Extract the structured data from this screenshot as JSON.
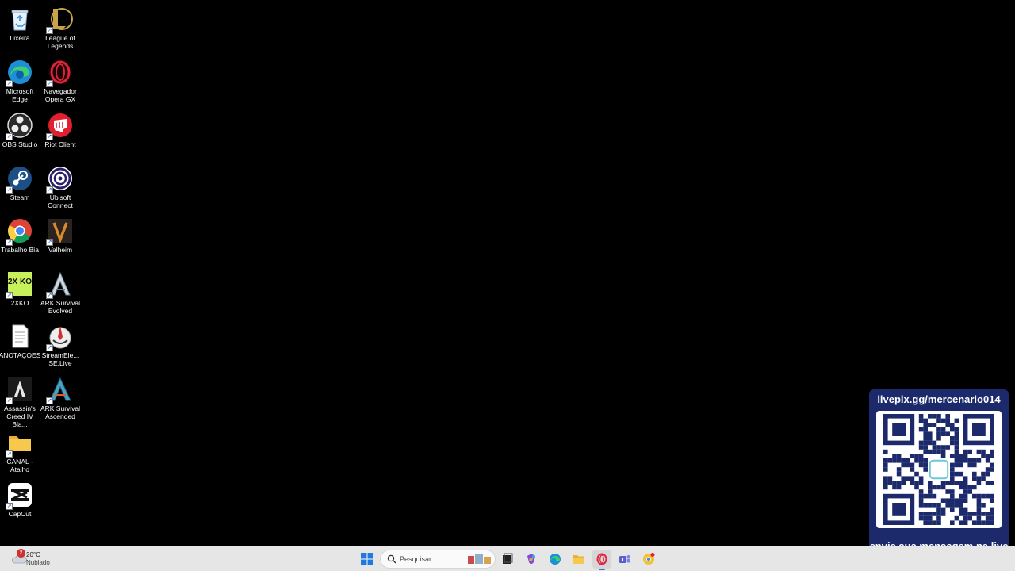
{
  "desktop": {
    "icons": [
      {
        "label": "Lixeira",
        "icon": "recycle-bin-icon"
      },
      {
        "label": "League of Legends",
        "icon": "league-of-legends-icon"
      },
      {
        "label": "Microsoft Edge",
        "icon": "edge-icon"
      },
      {
        "label": "Navegador Opera GX",
        "icon": "opera-gx-icon"
      },
      {
        "label": "OBS Studio",
        "icon": "obs-icon"
      },
      {
        "label": "Riot Client",
        "icon": "riot-client-icon"
      },
      {
        "label": "Steam",
        "icon": "steam-icon"
      },
      {
        "label": "Ubisoft Connect",
        "icon": "ubisoft-icon"
      },
      {
        "label": "Trabalho Bia",
        "icon": "chrome-icon"
      },
      {
        "label": "Valheim",
        "icon": "valheim-icon"
      },
      {
        "label": "2XKO",
        "icon": "2xko-icon",
        "icon_text": "2X KO"
      },
      {
        "label": "ARK Survival Evolved",
        "icon": "ark-icon"
      },
      {
        "label": "ANOTAÇOES",
        "icon": "text-file-icon"
      },
      {
        "label": "StreamEle... SE.Live",
        "icon": "streamelements-icon"
      },
      {
        "label": "Assassin's Creed IV Bla...",
        "icon": "assassins-creed-icon"
      },
      {
        "label": "ARK Survival Ascended",
        "icon": "ark-ascended-icon"
      },
      {
        "label": "CANAL - Atalho",
        "icon": "folder-icon"
      },
      {
        "label": "CapCut",
        "icon": "capcut-icon"
      }
    ]
  },
  "overlay": {
    "url": "livepix.gg/mercenario014",
    "message": "envie sua mensagem na live via pix!",
    "qr_icon": "qr-code-icon"
  },
  "taskbar": {
    "weather": {
      "temp": "20°C",
      "condition": "Nublado",
      "badge": "2",
      "icon": "cloud-icon"
    },
    "search": {
      "placeholder": "Pesquisar",
      "icon": "search-icon"
    },
    "apps": [
      {
        "name": "start-button",
        "icon": "windows-icon"
      },
      {
        "name": "task-view",
        "icon": "task-view-icon"
      },
      {
        "name": "copilot",
        "icon": "copilot-icon"
      },
      {
        "name": "edge",
        "icon": "edge-icon"
      },
      {
        "name": "file-explorer",
        "icon": "folder-icon"
      },
      {
        "name": "opera-gx",
        "icon": "opera-gx-icon"
      },
      {
        "name": "teams",
        "icon": "teams-icon"
      },
      {
        "name": "chrome",
        "icon": "chrome-icon"
      }
    ]
  },
  "colors": {
    "desktop_bg": "#000000",
    "taskbar_bg": "#e6e6e6",
    "overlay_bg": "#1c2a6b",
    "qr_color": "#1c2a6b",
    "accent": "#3a6fd8"
  }
}
